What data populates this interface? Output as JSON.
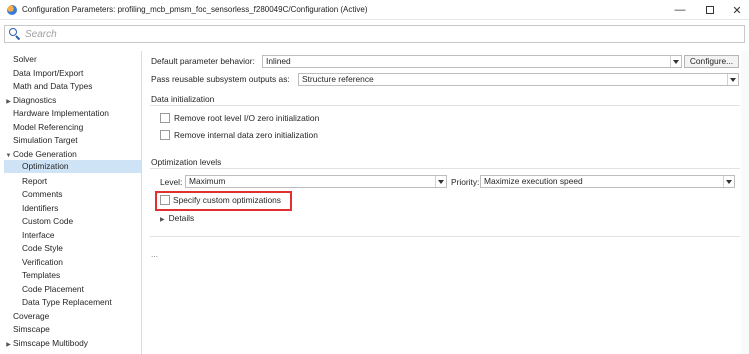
{
  "window": {
    "title": "Configuration Parameters: profiling_mcb_pmsm_foc_sensorless_f280049C/Configuration (Active)",
    "minimize": "—",
    "close": "✕"
  },
  "search": {
    "placeholder": "Search"
  },
  "sidebar": {
    "items": [
      {
        "label": "Solver",
        "expander": ""
      },
      {
        "label": "Data Import/Export",
        "expander": ""
      },
      {
        "label": "Math and Data Types",
        "expander": ""
      },
      {
        "label": "Diagnostics",
        "expander": "▶"
      },
      {
        "label": "Hardware Implementation",
        "expander": ""
      },
      {
        "label": "Model Referencing",
        "expander": ""
      },
      {
        "label": "Simulation Target",
        "expander": ""
      },
      {
        "label": "Code Generation",
        "expander": "▼"
      },
      {
        "label": "Optimization",
        "expander": ""
      },
      {
        "label": "Report",
        "expander": ""
      },
      {
        "label": "Comments",
        "expander": ""
      },
      {
        "label": "Identifiers",
        "expander": ""
      },
      {
        "label": "Custom Code",
        "expander": ""
      },
      {
        "label": "Interface",
        "expander": ""
      },
      {
        "label": "Code Style",
        "expander": ""
      },
      {
        "label": "Verification",
        "expander": ""
      },
      {
        "label": "Templates",
        "expander": ""
      },
      {
        "label": "Code Placement",
        "expander": ""
      },
      {
        "label": "Data Type Replacement",
        "expander": ""
      },
      {
        "label": "Coverage",
        "expander": ""
      },
      {
        "label": "Simscape",
        "expander": ""
      },
      {
        "label": "Simscape Multibody",
        "expander": "▶"
      }
    ],
    "selected": "Optimization"
  },
  "main": {
    "default_param_label": "Default parameter behavior:",
    "default_param_value": "Inlined",
    "configure_button": "Configure...",
    "pass_reusable_label": "Pass reusable subsystem outputs as:",
    "pass_reusable_value": "Structure reference",
    "data_init_heading": "Data initialization",
    "remove_root_label": "Remove root level I/O zero initialization",
    "remove_internal_label": "Remove internal data zero initialization",
    "opt_levels_heading": "Optimization levels",
    "level_label": "Level:",
    "level_value": "Maximum",
    "priority_label": "Priority:",
    "priority_value": "Maximize execution speed",
    "specify_custom_label": "Specify custom optimizations",
    "details_label": "Details",
    "ellipsis": "..."
  },
  "colors": {
    "selection": "#cfe3f7",
    "highlight": "#e03030",
    "search_icon": "#2a5db0"
  }
}
